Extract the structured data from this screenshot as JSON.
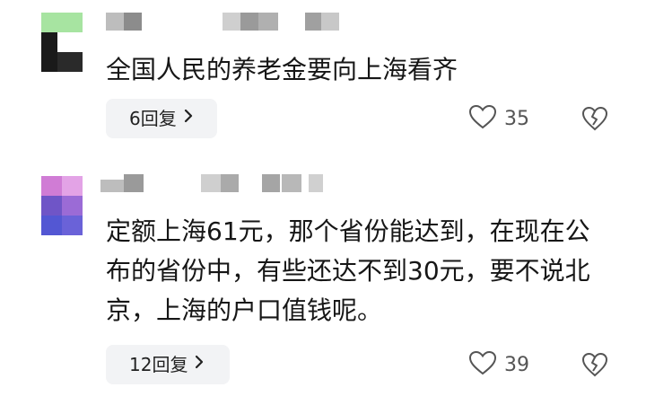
{
  "comments": [
    {
      "text": "全国人民的养老金要向上海看齐",
      "reply_label": "6回复",
      "like_count": "35",
      "icons": {
        "like": "heart-outline-icon",
        "dislike": "broken-heart-icon",
        "chevron": "chevron-right-icon"
      },
      "colors": {
        "avatar": [
          "#a7e4a1",
          "#9ed59a",
          "#ffffff",
          "#1a1a1a",
          "#2a2a2a",
          "#ffffff"
        ]
      }
    },
    {
      "text": "定额上海61元，那个省份能达到，在现在公布的省份中，有些还达不到30元，要不说北京，上海的户口值钱呢。",
      "reply_label": "12回复",
      "like_count": "39",
      "icons": {
        "like": "heart-outline-icon",
        "dislike": "broken-heart-icon",
        "chevron": "chevron-right-icon"
      },
      "colors": {
        "avatar": [
          "#d07cd5",
          "#9b6bd6",
          "#6f55c7",
          "#5a5acd",
          "#5357d3",
          "#6a62d8"
        ]
      }
    }
  ]
}
